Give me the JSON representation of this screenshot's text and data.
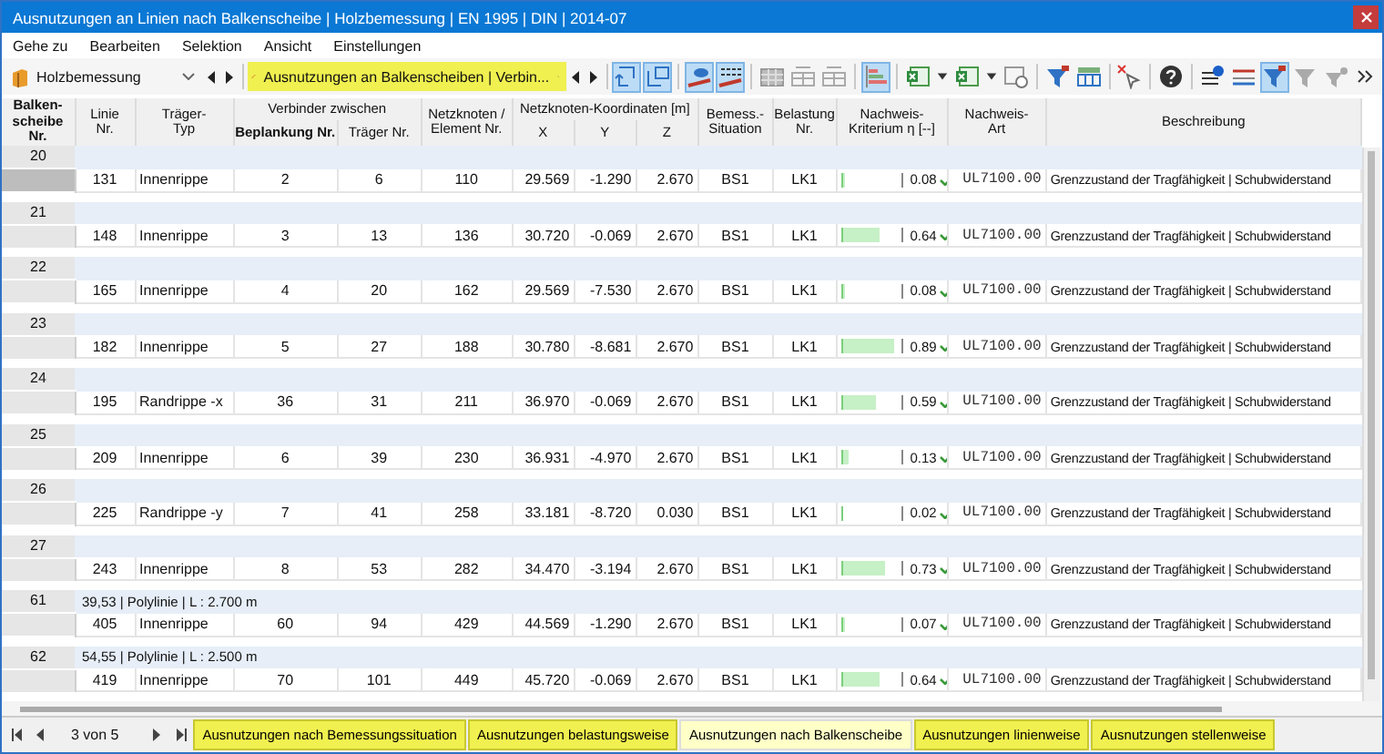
{
  "window": {
    "title": "Ausnutzungen an Linien nach Balkenscheibe | Holzbemessung | EN 1995 | DIN | 2014-07"
  },
  "menu": [
    "Gehe zu",
    "Bearbeiten",
    "Selektion",
    "Ansicht",
    "Einstellungen"
  ],
  "module_dropdown": {
    "value": "Holzbemessung"
  },
  "table_dropdown": {
    "value": "Ausnutzungen an Balkenscheiben | Verbin..."
  },
  "toolbar": [
    {
      "kind": "select",
      "selected": true
    },
    {
      "kind": "select-alt",
      "selected": true
    },
    {
      "kind": "separator"
    },
    {
      "kind": "view",
      "selected": true
    },
    {
      "kind": "view-values",
      "selected": true
    },
    {
      "kind": "separator"
    },
    {
      "kind": "table",
      "selected": false
    },
    {
      "kind": "table-cols",
      "selected": false
    },
    {
      "kind": "table-cols",
      "selected": false
    },
    {
      "kind": "separator"
    },
    {
      "kind": "bars",
      "selected": true
    },
    {
      "kind": "separator"
    },
    {
      "kind": "export",
      "selected": false
    },
    {
      "kind": "caret",
      "selected": false
    },
    {
      "kind": "export",
      "selected": false
    },
    {
      "kind": "caret",
      "selected": false
    },
    {
      "kind": "settings",
      "selected": false
    },
    {
      "kind": "separator"
    },
    {
      "kind": "filter",
      "selected": false
    },
    {
      "kind": "columns",
      "selected": false
    },
    {
      "kind": "separator"
    },
    {
      "kind": "cursor",
      "selected": false
    },
    {
      "kind": "separator"
    },
    {
      "kind": "help",
      "selected": false
    },
    {
      "kind": "separator"
    },
    {
      "kind": "info",
      "selected": false
    },
    {
      "kind": "lines",
      "selected": false
    },
    {
      "kind": "filter",
      "selected": true
    },
    {
      "kind": "filter-grey",
      "selected": false
    },
    {
      "kind": "pin",
      "selected": false
    },
    {
      "kind": "more",
      "selected": false
    }
  ],
  "table": {
    "columns": [
      {
        "kind": "single",
        "lines": [
          "Balken-",
          "scheibe",
          "Nr."
        ]
      },
      {
        "kind": "single",
        "lines": [
          "Linie",
          "Nr."
        ]
      },
      {
        "kind": "single",
        "lines": [
          "Träger-",
          "Typ"
        ]
      },
      {
        "kind": "group",
        "label": "Verbinder zwischen",
        "sub": [
          "Beplankung Nr.",
          "Träger Nr."
        ]
      },
      {
        "kind": "single",
        "lines": [
          "Netzknoten /",
          "Element Nr."
        ]
      },
      {
        "kind": "group",
        "label": "Netzknoten-Koordinaten [m]",
        "sub": [
          "X",
          "Y",
          "Z"
        ]
      },
      {
        "kind": "single",
        "lines": [
          "Bemess.-",
          "Situation"
        ]
      },
      {
        "kind": "single",
        "lines": [
          "Belastung",
          "Nr."
        ]
      },
      {
        "kind": "single",
        "lines": [
          "Nachweis-",
          "Kriterium η [--]"
        ]
      },
      {
        "kind": "single",
        "lines": [
          "Nachweis-",
          "Art"
        ]
      },
      {
        "kind": "single",
        "lines": [
          "Beschreibung"
        ]
      }
    ],
    "groups": [
      {
        "number": "20",
        "row": {
          "selected": true,
          "cells": [
            "131",
            "Innenrippe",
            "2",
            "6",
            "110",
            "29.569",
            "-1.290",
            "2.670",
            "BS1",
            "LK1"
          ],
          "level": 0.08,
          "ratio": "0.08",
          "art": "UL7100.00",
          "description": "Grenzzustand der Tragfähigkeit | Schubwiderstand"
        }
      },
      {
        "number": "21",
        "row": {
          "selected": false,
          "cells": [
            "148",
            "Innenrippe",
            "3",
            "13",
            "136",
            "30.720",
            "-0.069",
            "2.670",
            "BS1",
            "LK1"
          ],
          "level": 0.64,
          "ratio": "0.64",
          "art": "UL7100.00",
          "description": "Grenzzustand der Tragfähigkeit | Schubwiderstand"
        }
      },
      {
        "number": "22",
        "row": {
          "selected": false,
          "cells": [
            "165",
            "Innenrippe",
            "4",
            "20",
            "162",
            "29.569",
            "-7.530",
            "2.670",
            "BS1",
            "LK1"
          ],
          "level": 0.08,
          "ratio": "0.08",
          "art": "UL7100.00",
          "description": "Grenzzustand der Tragfähigkeit | Schubwiderstand"
        }
      },
      {
        "number": "23",
        "row": {
          "selected": false,
          "cells": [
            "182",
            "Innenrippe",
            "5",
            "27",
            "188",
            "30.780",
            "-8.681",
            "2.670",
            "BS1",
            "LK1"
          ],
          "level": 0.89,
          "ratio": "0.89",
          "art": "UL7100.00",
          "description": "Grenzzustand der Tragfähigkeit | Schubwiderstand"
        }
      },
      {
        "number": "24",
        "row": {
          "selected": false,
          "cells": [
            "195",
            "Randrippe -x",
            "36",
            "31",
            "211",
            "36.970",
            "-0.069",
            "2.670",
            "BS1",
            "LK1"
          ],
          "level": 0.59,
          "ratio": "0.59",
          "art": "UL7100.00",
          "description": "Grenzzustand der Tragfähigkeit | Schubwiderstand"
        }
      },
      {
        "number": "25",
        "row": {
          "selected": false,
          "cells": [
            "209",
            "Innenrippe",
            "6",
            "39",
            "230",
            "36.931",
            "-4.970",
            "2.670",
            "BS1",
            "LK1"
          ],
          "level": 0.13,
          "ratio": "0.13",
          "art": "UL7100.00",
          "description": "Grenzzustand der Tragfähigkeit | Schubwiderstand"
        }
      },
      {
        "number": "26",
        "row": {
          "selected": false,
          "cells": [
            "225",
            "Randrippe -y",
            "7",
            "41",
            "258",
            "33.181",
            "-8.720",
            "0.030",
            "BS1",
            "LK1"
          ],
          "level": 0.02,
          "ratio": "0.02",
          "art": "UL7100.00",
          "description": "Grenzzustand der Tragfähigkeit | Schubwiderstand"
        }
      },
      {
        "number": "27",
        "row": {
          "selected": false,
          "cells": [
            "243",
            "Innenrippe",
            "8",
            "53",
            "282",
            "34.470",
            "-3.194",
            "2.670",
            "BS1",
            "LK1"
          ],
          "level": 0.73,
          "ratio": "0.73",
          "art": "UL7100.00",
          "description": "Grenzzustand der Tragfähigkeit | Schubwiderstand"
        }
      },
      {
        "number": "61",
        "info": "39,53 | Polylinie | L : 2.700 m",
        "row": {
          "selected": false,
          "cells": [
            "405",
            "Innenrippe",
            "60",
            "94",
            "429",
            "44.569",
            "-1.290",
            "2.670",
            "BS1",
            "LK1"
          ],
          "level": 0.07,
          "ratio": "0.07",
          "art": "UL7100.00",
          "description": "Grenzzustand der Tragfähigkeit | Schubwiderstand"
        }
      },
      {
        "number": "62",
        "info": "54,55 | Polylinie | L : 2.500 m",
        "row": {
          "selected": false,
          "cells": [
            "419",
            "Innenrippe",
            "70",
            "101",
            "449",
            "45.720",
            "-0.069",
            "2.670",
            "BS1",
            "LK1"
          ],
          "level": 0.64,
          "ratio": "0.64",
          "art": "UL7100.00",
          "description": "Grenzzustand der Tragfähigkeit | Schubwiderstand"
        }
      }
    ]
  },
  "pager": {
    "text": "3 von 5"
  },
  "sheet_tabs": [
    {
      "label": "Ausnutzungen nach Bemessungssituation",
      "selected": false
    },
    {
      "label": "Ausnutzungen belastungsweise",
      "selected": false
    },
    {
      "label": "Ausnutzungen nach Balkenscheibe",
      "selected": true
    },
    {
      "label": "Ausnutzungen linienweise",
      "selected": false
    },
    {
      "label": "Ausnutzungen stellenweise",
      "selected": false
    }
  ]
}
